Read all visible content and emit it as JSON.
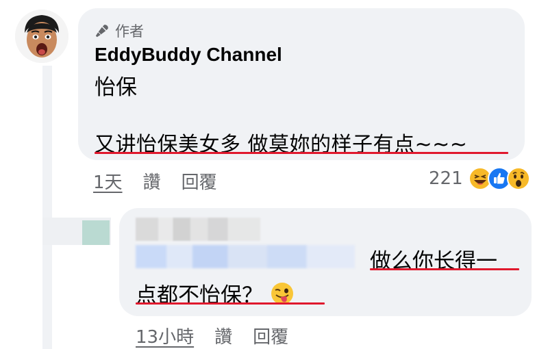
{
  "main_comment": {
    "badge_label": "作者",
    "author": "EddyBuddy Channel",
    "line1": "怡保",
    "line2": "又讲怡保美女多 做莫妳的样子有点~~~",
    "actions": {
      "time": "1天",
      "like": "讚",
      "reply": "回覆"
    },
    "reaction_count": "221",
    "reaction_icons": [
      "haha-icon",
      "like-icon",
      "wow-icon"
    ]
  },
  "reply_comment": {
    "line1": "做么你长得一",
    "line2": "点都不怡保？",
    "emoji": "winking-tongue-face-icon",
    "actions": {
      "time": "13小時",
      "like": "讚",
      "reply": "回覆"
    }
  },
  "colors": {
    "bubble": "#f0f2f5",
    "underline": "#e0182d",
    "meta_text": "#65676b",
    "like_blue": "#1877f2",
    "reaction_yellow": "#f7b928"
  }
}
